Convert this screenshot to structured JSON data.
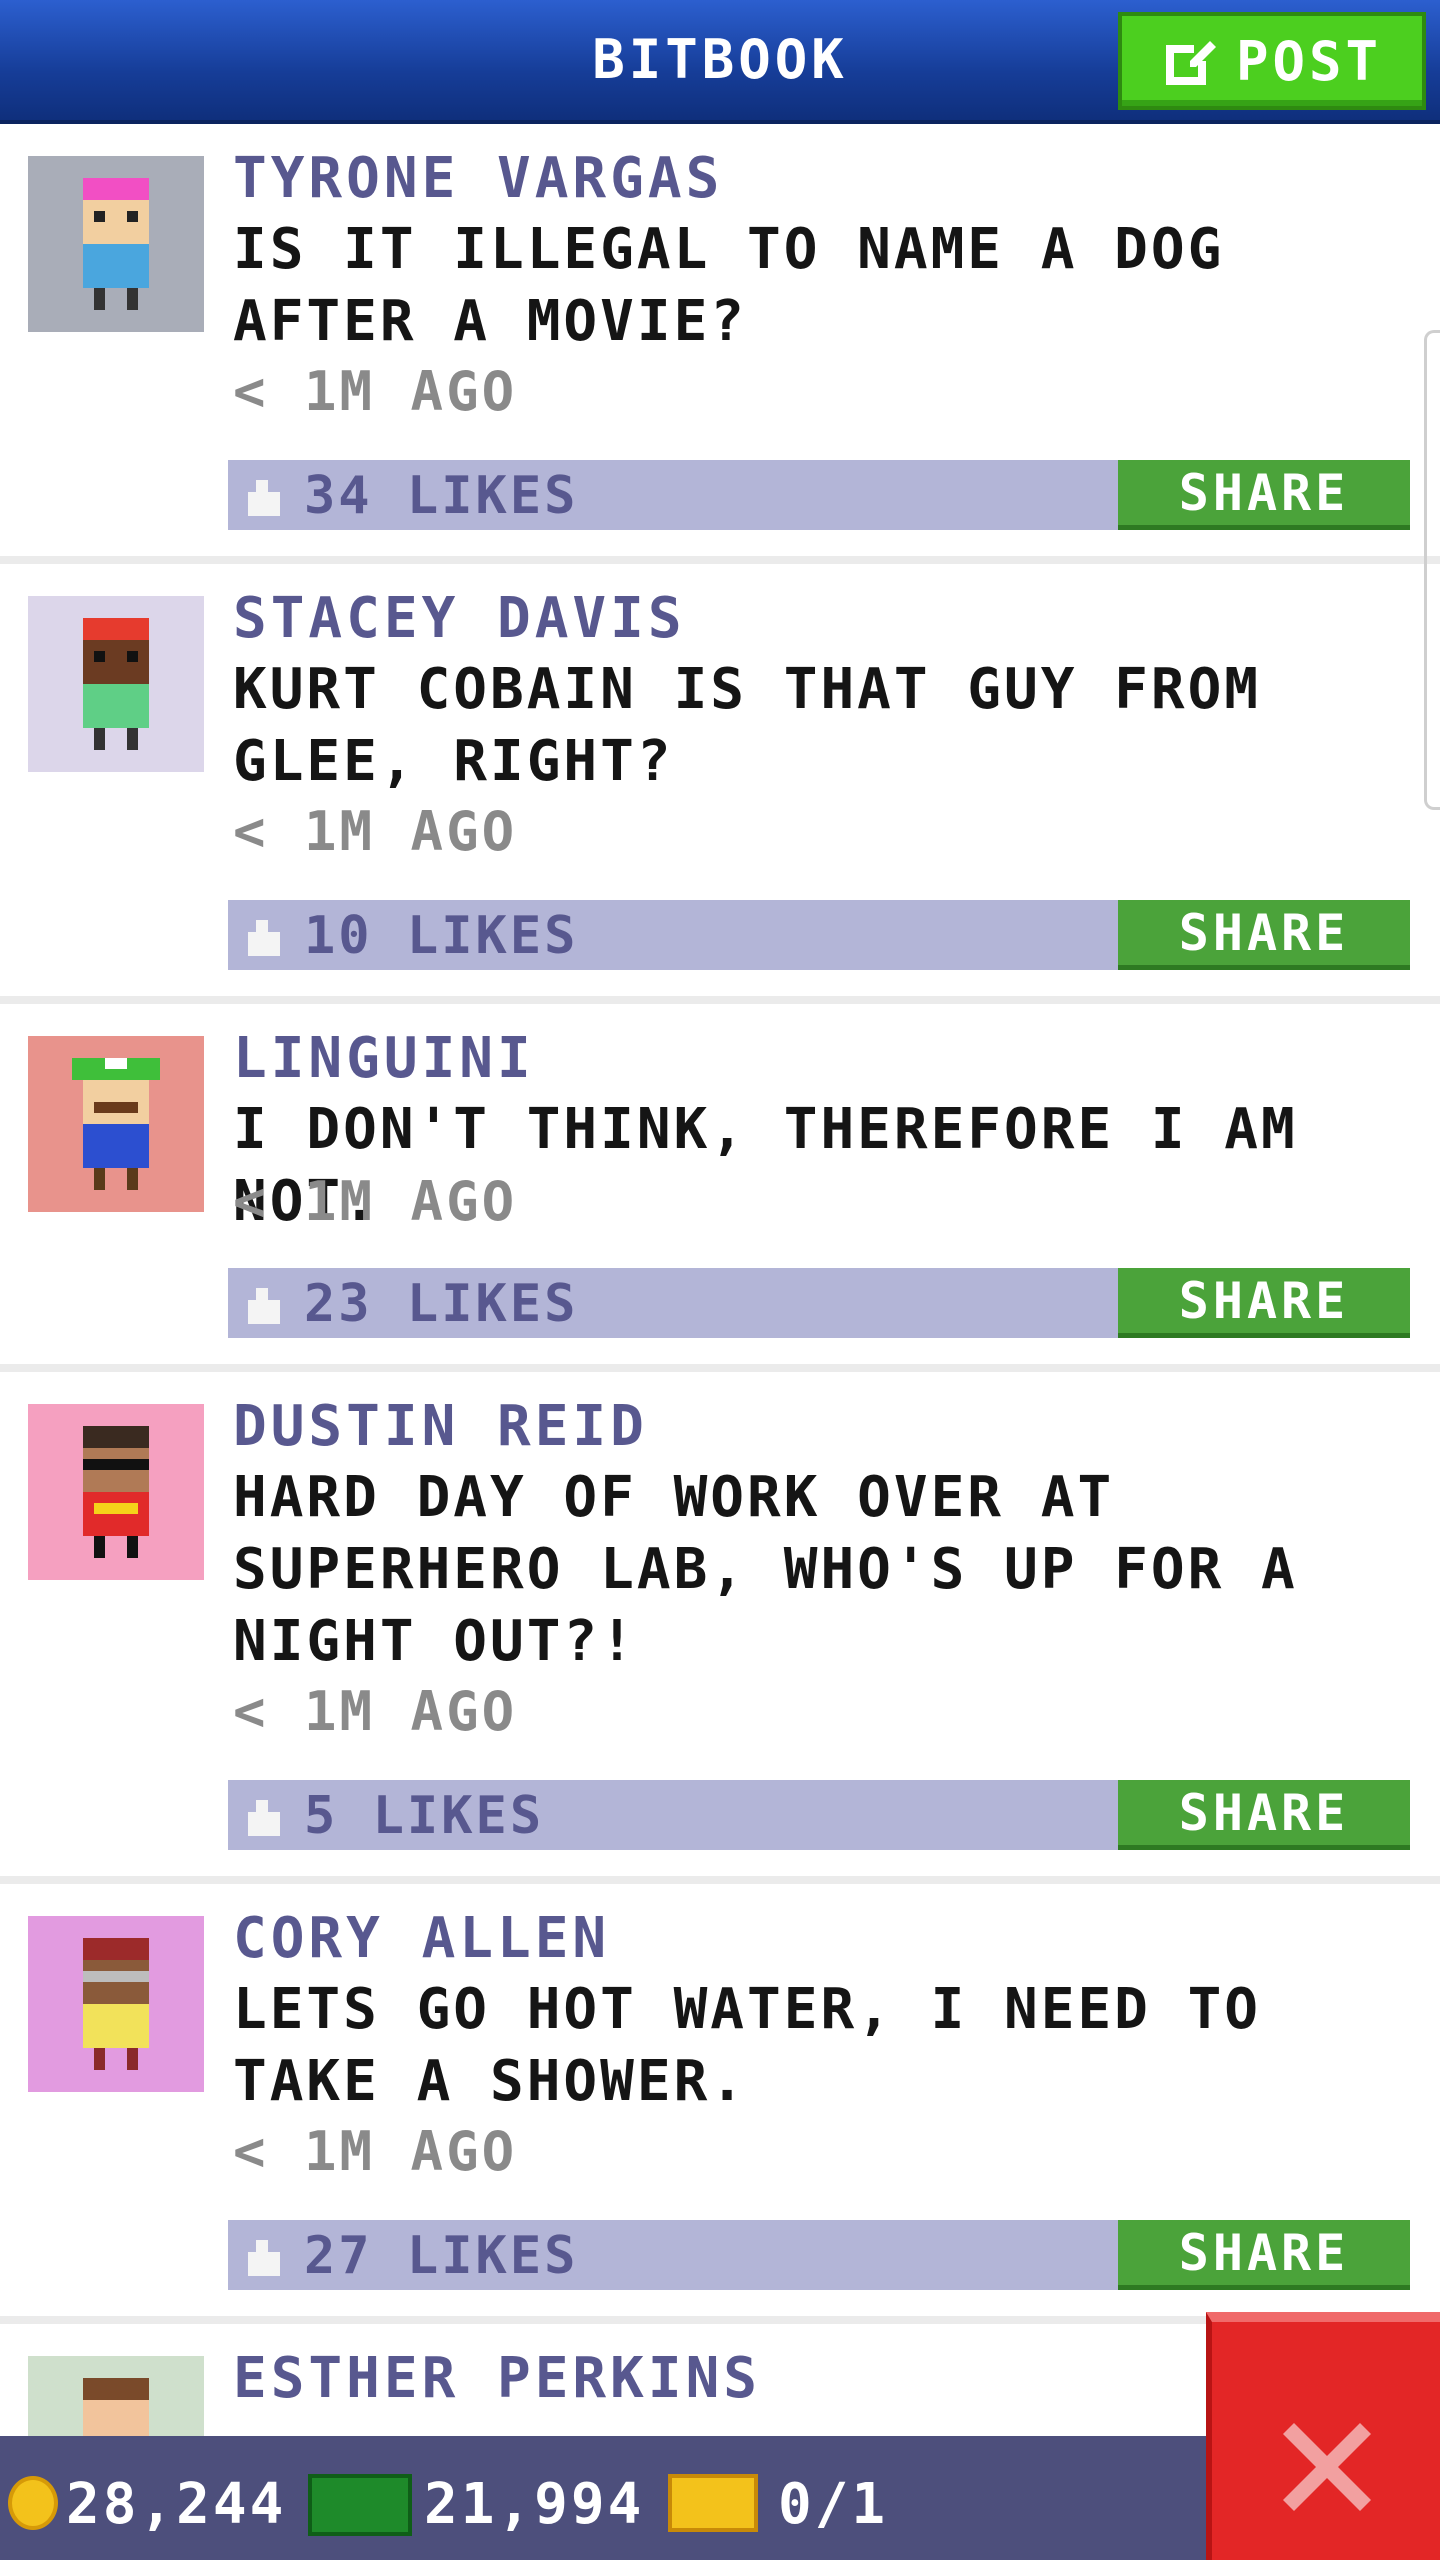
{
  "header": {
    "title": "BITBOOK",
    "post_label": "POST"
  },
  "posts": [
    {
      "name": "TYRONE VARGAS",
      "text": "IS IT ILLEGAL TO NAME A DOG AFTER A MOVIE?",
      "time": "< 1M AGO",
      "likes": "34 LIKES",
      "share": "SHARE",
      "avatar_bg": "#a9adb8"
    },
    {
      "name": "STACEY DAVIS",
      "text": "KURT COBAIN IS THAT GUY FROM GLEE, RIGHT?",
      "time": "< 1M AGO",
      "likes": "10 LIKES",
      "share": "SHARE",
      "avatar_bg": "#dcd6ea"
    },
    {
      "name": "LINGUINI",
      "text": "I DON'T THINK, THEREFORE I AM NOT.",
      "time": "< 1M AGO",
      "likes": "23 LIKES",
      "share": "SHARE",
      "avatar_bg": "#e8938c"
    },
    {
      "name": "DUSTIN REID",
      "text": "HARD DAY OF WORK OVER AT SUPERHERO LAB, WHO'S UP FOR A NIGHT OUT?!",
      "time": "< 1M AGO",
      "likes": "5 LIKES",
      "share": "SHARE",
      "avatar_bg": "#f5a0c0"
    },
    {
      "name": "CORY ALLEN",
      "text": "LETS GO HOT WATER, I NEED TO TAKE A SHOWER.",
      "time": "< 1M AGO",
      "likes": "27 LIKES",
      "share": "SHARE",
      "avatar_bg": "#e29be0"
    },
    {
      "name": "ESTHER PERKINS",
      "avatar_bg": "#cfe0cc"
    }
  ],
  "bottom_bar": {
    "coins": "28,244",
    "bux": "21,994",
    "tickets": "0/1"
  },
  "colors": {
    "header": "#163d98",
    "post_button": "#4ccf1f",
    "name": "#58588f",
    "like_bar": "#b3b5d7",
    "share": "#4ba33a",
    "bottom_bar": "#4d4f7c",
    "close": "#e32626"
  }
}
